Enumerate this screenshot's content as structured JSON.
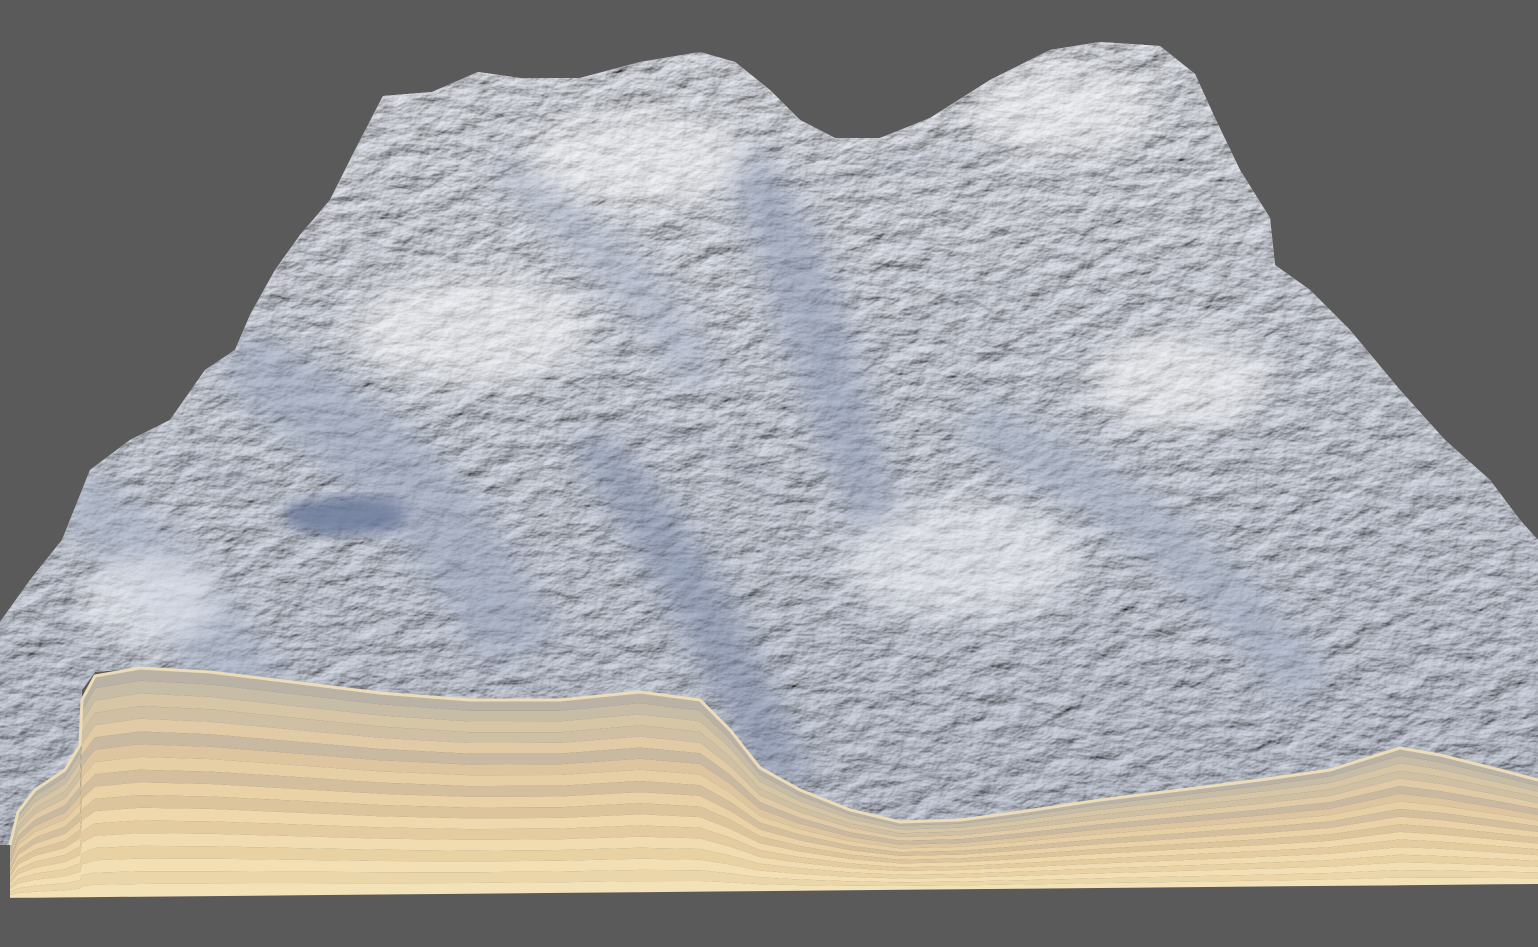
{
  "scene": {
    "background_color": "#5a5a5a",
    "snow_colors": {
      "highlight": "#f4f6fb",
      "base": "#dfe4ef",
      "mid": "#c3cadb",
      "shadow": "#8e9ab5",
      "deep_shadow": "#5f6e90"
    },
    "strata_colors": [
      "#b9b2a5",
      "#c7bca6",
      "#d6c6a6",
      "#cfbfa3",
      "#e0cba6",
      "#c9b9a0",
      "#ddc5a0",
      "#e6cfa5",
      "#d3bf9d",
      "#ead2a6",
      "#dcc49c",
      "#efd8ab",
      "#e4cca0",
      "#f0dcb0",
      "#e8d2a4",
      "#f2dfb4",
      "#ead6a8",
      "#f3e2b8"
    ],
    "edge_color": "#ecdcb8"
  }
}
